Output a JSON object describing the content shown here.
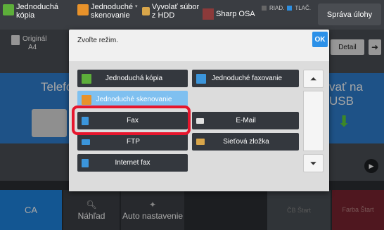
{
  "topbar": {
    "simple_copy": "Jednoduchá kópia",
    "simple_scan": "Jednoduché skenovanie",
    "recall_hdd": "Vyvolať súbor z HDD",
    "sharp_osa": "Sharp OSA",
    "status_line": "RIAD.",
    "status_print": "TLAČ.",
    "manage_jobs": "Správa úlohy"
  },
  "background": {
    "original_label": "Originál",
    "original_size": "A4",
    "detail": "Detail",
    "left_tile_text": "Telefó",
    "right_tile_text": "vať na USB"
  },
  "bottombar": {
    "ca": "CA",
    "preview": "Náhľad",
    "auto_setting": "Auto nastavenie",
    "bw_start": "ČB Štart",
    "color_start": "Farba Štart"
  },
  "dialog": {
    "title": "Zvoľte režim.",
    "ok": "OK",
    "modes": [
      "Jednoduchá kópia",
      "Jednoduché faxovanie",
      "Jednoduché skenovanie",
      "Fax",
      "E-Mail",
      "FTP",
      "Sieťová zložka",
      "Internet fax"
    ]
  }
}
